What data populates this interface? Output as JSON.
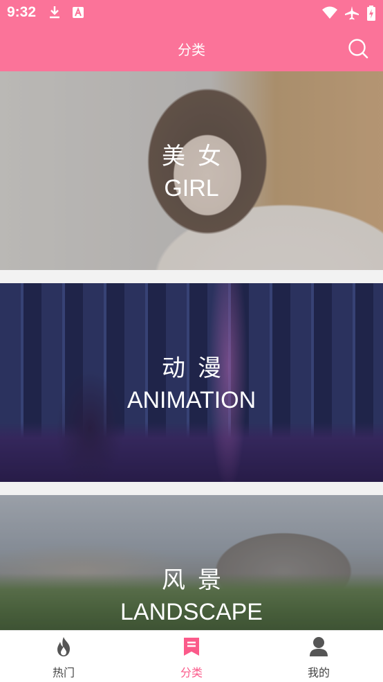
{
  "status_bar": {
    "time": "9:32"
  },
  "app_bar": {
    "title": "分类"
  },
  "categories": [
    {
      "zh": "美女",
      "en": "GIRL"
    },
    {
      "zh": "动漫",
      "en": "ANIMATION"
    },
    {
      "zh": "风景",
      "en": "LANDSCAPE"
    }
  ],
  "bottom_nav": {
    "items": [
      {
        "label": "热门",
        "icon": "flame-icon"
      },
      {
        "label": "分类",
        "icon": "bookmark-list-icon",
        "active": true
      },
      {
        "label": "我的",
        "icon": "person-icon"
      }
    ]
  },
  "colors": {
    "accent": "#fb7399",
    "active_tab": "#fb5a8a",
    "inactive_tab": "#444444"
  }
}
